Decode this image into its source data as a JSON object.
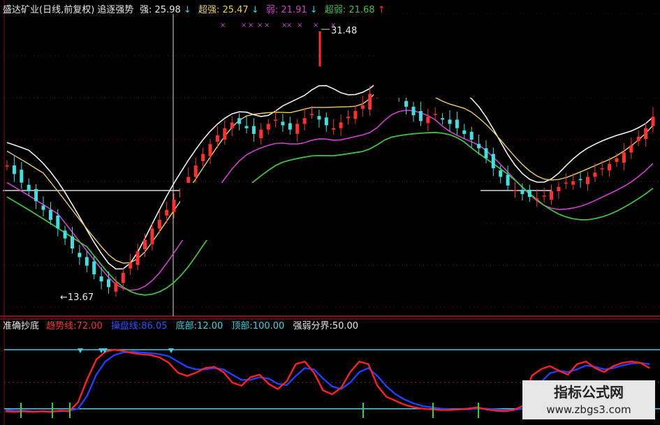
{
  "header": {
    "stock_title": "盛达矿业(日线,前复权)",
    "indicator_name": "追逐强势",
    "strong_label": "强:",
    "strong_value": "25.98",
    "super_strong_label": "超强:",
    "super_strong_value": "25.47",
    "weak_label": "弱:",
    "weak_value": "21.91",
    "super_weak_label": "超弱:",
    "super_weak_value": "21.68"
  },
  "subpanel": {
    "name": "准确抄底",
    "trend_label": "趋势线:",
    "trend_value": "72.00",
    "control_label": "操盘线:",
    "control_value": "86.05",
    "bottom_label": "底部:",
    "bottom_value": "12.00",
    "top_label": "顶部:",
    "top_value": "100.00",
    "divide_label": "强弱分界:",
    "divide_value": "50.00"
  },
  "annotations": {
    "high_label": "31.48",
    "low_label": "←13.67"
  },
  "watermark": {
    "line1": "指标公式网",
    "line2": "www.zbgs3.com"
  },
  "colors": {
    "up": "#ff3030",
    "down": "#40e0e0",
    "ma_white": "#f0f0f0",
    "ma_yellow": "#e8d060",
    "ma_magenta": "#d040d0",
    "ma_green": "#40c040",
    "trend_red": "#ff2020",
    "control_blue": "#2040ff",
    "grid_red": "#8a1010",
    "level_cyan": "#40d0e0"
  },
  "chart_data": [
    {
      "type": "candlestick",
      "title": "盛达矿业(日线,前复权) 追逐强势",
      "price_high": 31.48,
      "price_low": 13.67,
      "close_path": [
        22.4,
        21.8,
        21.2,
        20.6,
        19.9,
        19.3,
        18.6,
        18.0,
        17.3,
        16.6,
        16.0,
        15.4,
        14.8,
        14.3,
        13.9,
        14.2,
        14.9,
        15.6,
        16.4,
        17.2,
        18.0,
        18.6,
        19.3,
        20.0,
        20.8,
        21.6,
        22.4,
        23.2,
        23.9,
        24.5,
        25.0,
        25.4,
        25.3,
        25.0,
        24.6,
        24.9,
        25.3,
        25.6,
        25.2,
        24.9,
        25.3,
        25.7,
        26.0,
        25.6,
        25.2,
        25.0,
        25.4,
        25.8,
        26.2,
        26.6,
        27.4,
        28.3,
        29.2,
        28.2,
        27.2,
        26.5,
        25.9,
        25.5,
        25.8,
        26.0,
        25.6,
        25.3,
        25.0,
        24.6,
        24.2,
        23.6,
        22.9,
        22.2,
        21.6,
        21.0,
        20.7,
        20.4,
        20.2,
        20.1,
        20.3,
        20.6,
        20.9,
        21.2,
        21.3,
        21.4,
        21.6,
        21.9,
        22.2,
        22.5,
        22.9,
        23.3,
        23.8,
        24.4,
        25.0,
        25.8
      ]
    },
    {
      "type": "line",
      "title": "准确抄底",
      "levels": {
        "bottom": 12.0,
        "top": 100.0,
        "divide": 50.0
      },
      "series": [
        {
          "name": "趋势线",
          "last": 72.0,
          "values": [
            6,
            5,
            6,
            5,
            6,
            5,
            7,
            6,
            20,
            55,
            85,
            97,
            100,
            98,
            95,
            93,
            92,
            88,
            80,
            65,
            60,
            65,
            72,
            74,
            66,
            50,
            45,
            58,
            62,
            48,
            40,
            52,
            78,
            82,
            65,
            38,
            32,
            42,
            66,
            82,
            78,
            45,
            28,
            22,
            16,
            12,
            10,
            9,
            8,
            8,
            9,
            10,
            12,
            9,
            7,
            6,
            8,
            14,
            60,
            70,
            75,
            68,
            62,
            78,
            82,
            72,
            66,
            75,
            80,
            82,
            80,
            72
          ]
        },
        {
          "name": "操盘线",
          "last": 86.05,
          "values": [
            8,
            7,
            7,
            6,
            6,
            6,
            6,
            7,
            10,
            30,
            62,
            82,
            92,
            96,
            97,
            96,
            95,
            93,
            90,
            82,
            74,
            70,
            70,
            72,
            70,
            62,
            54,
            54,
            58,
            56,
            48,
            46,
            60,
            72,
            70,
            56,
            44,
            40,
            50,
            66,
            72,
            60,
            44,
            32,
            24,
            18,
            14,
            12,
            10,
            9,
            9,
            9,
            10,
            10,
            9,
            8,
            8,
            10,
            30,
            50,
            64,
            68,
            66,
            70,
            76,
            74,
            70,
            72,
            76,
            79,
            80,
            78
          ]
        }
      ]
    }
  ]
}
